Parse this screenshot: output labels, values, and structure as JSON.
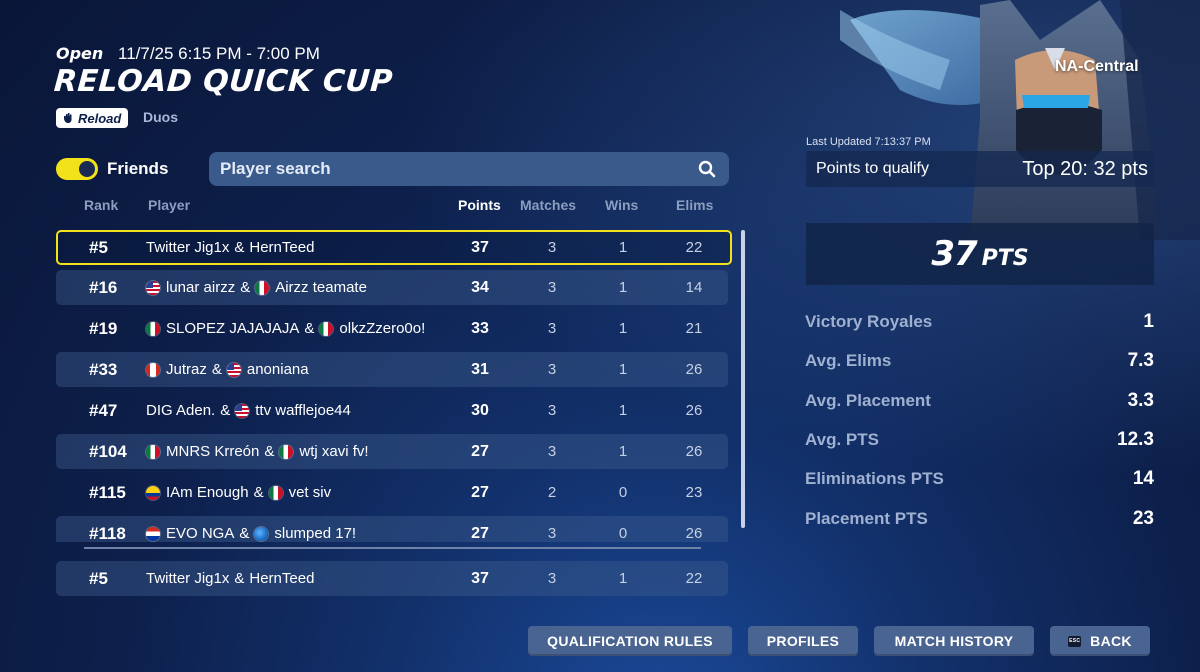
{
  "event": {
    "status": "Open",
    "time": "11/7/25 6:15 PM - 7:00 PM",
    "title": "RELOAD QUICK CUP",
    "mode": "Reload",
    "team_type": "Duos",
    "region": "NA-Central"
  },
  "controls": {
    "friends_label": "Friends",
    "friends_on": true,
    "search_placeholder": "Player search"
  },
  "table": {
    "headers": {
      "rank": "Rank",
      "player": "Player",
      "points": "Points",
      "matches": "Matches",
      "wins": "Wins",
      "elims": "Elims"
    },
    "rows": [
      {
        "rank": "#5",
        "p1": "Twitter Jig1x",
        "p2": "HernTeed",
        "points": "37",
        "matches": "3",
        "wins": "1",
        "elims": "22"
      },
      {
        "rank": "#16",
        "p1": "lunar airzz",
        "p2": "Airzz teamate",
        "points": "34",
        "matches": "3",
        "wins": "1",
        "elims": "14"
      },
      {
        "rank": "#19",
        "p1": "SLOPEZ JAJAJAJA",
        "p2": "olkzZzero0o!",
        "points": "33",
        "matches": "3",
        "wins": "1",
        "elims": "21"
      },
      {
        "rank": "#33",
        "p1": "Jutraz",
        "p2": "anoniana",
        "points": "31",
        "matches": "3",
        "wins": "1",
        "elims": "26"
      },
      {
        "rank": "#47",
        "p1": "DIG Aden.",
        "p2": "ttv wafflejoe44",
        "points": "30",
        "matches": "3",
        "wins": "1",
        "elims": "26"
      },
      {
        "rank": "#104",
        "p1": "MNRS Krreón",
        "p2": "wtj xavi fv!",
        "points": "27",
        "matches": "3",
        "wins": "1",
        "elims": "26"
      },
      {
        "rank": "#115",
        "p1": "IAm Enough",
        "p2": "vet siv",
        "points": "27",
        "matches": "2",
        "wins": "0",
        "elims": "23"
      },
      {
        "rank": "#118",
        "p1": "EVO NGA",
        "p2": "slumped 17!",
        "points": "27",
        "matches": "3",
        "wins": "0",
        "elims": "26"
      }
    ],
    "pinned": {
      "rank": "#5",
      "p1": "Twitter Jig1x",
      "p2": "HernTeed",
      "points": "37",
      "matches": "3",
      "wins": "1",
      "elims": "22"
    },
    "amp": "&"
  },
  "summary": {
    "last_updated": "Last Updated 7:13:37 PM",
    "qualify_label": "Points to qualify",
    "qualify_value": "Top 20: 32 pts",
    "points_value": "37",
    "points_unit": "PTS",
    "stats": [
      {
        "label": "Victory Royales",
        "value": "1"
      },
      {
        "label": "Avg. Elims",
        "value": "7.3"
      },
      {
        "label": "Avg. Placement",
        "value": "3.3"
      },
      {
        "label": "Avg. PTS",
        "value": "12.3"
      },
      {
        "label": "Eliminations PTS",
        "value": "14"
      },
      {
        "label": "Placement PTS",
        "value": "23"
      }
    ]
  },
  "buttons": {
    "qualification_rules": "QUALIFICATION RULES",
    "profiles": "PROFILES",
    "match_history": "MATCH HISTORY",
    "back": "BACK",
    "esc_key": "ESC"
  },
  "colors": {
    "accent_yellow": "#f2e21a",
    "background": "#0d1f4a",
    "button": "#4a6492"
  },
  "icons": {
    "search": "search-icon",
    "mode": "reload-hand-icon",
    "character": "hooded-masked-character-art"
  }
}
